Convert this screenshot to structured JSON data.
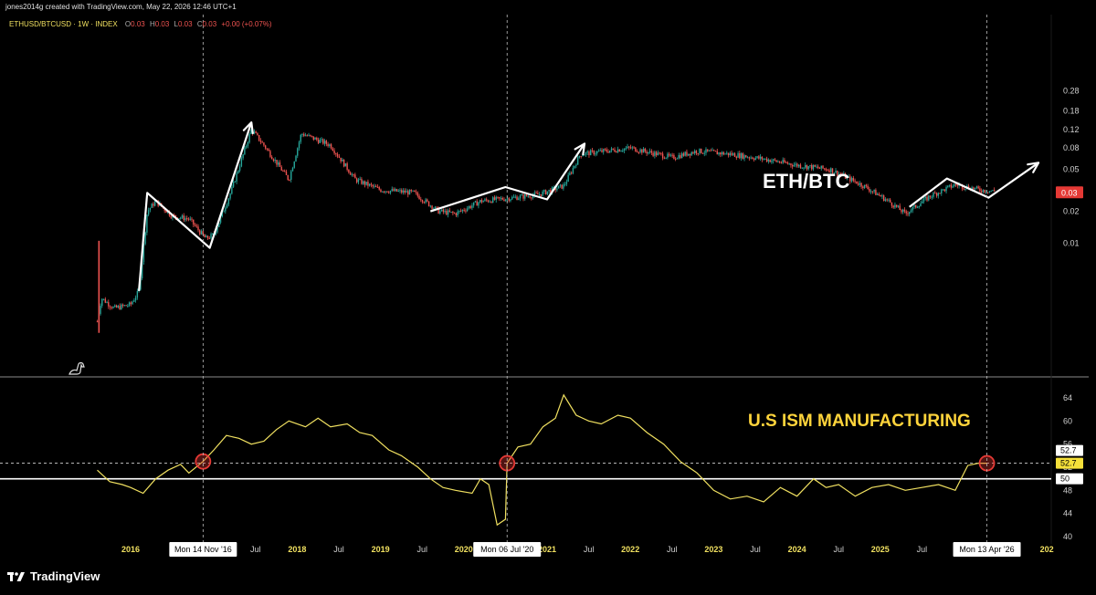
{
  "header": {
    "credit": "jones2014g created with TradingView.com, May 22, 2026 12:46 UTC+1"
  },
  "legend": {
    "symbol": "ETHUSD/BTCUSD · 1W · INDEX",
    "o_label": "O",
    "o_value": "0.03",
    "h_label": "H",
    "h_value": "0.03",
    "l_label": "L",
    "l_value": "0.03",
    "c_label": "C",
    "c_value": "0.03",
    "change": "+0.00 (+0.07%)"
  },
  "brand": {
    "name": "TradingView"
  },
  "colors": {
    "background": "#000000",
    "candle_up": "#26a69a",
    "candle_down": "#ef5350",
    "ism_line": "#f0e060",
    "annotation_text_yellow": "#ffd43b",
    "marker_red": "#e53935"
  },
  "chart_data": [
    {
      "type": "candlestick",
      "title": "ETH/BTC",
      "scale": "log",
      "y_ticks": [
        "0.28",
        "0.18",
        "0.12",
        "0.08",
        "0.05",
        "0.03",
        "0.02",
        "0.01"
      ],
      "last_value": "0.03",
      "close_path": [
        [
          2015.6,
          0.0018
        ],
        [
          2015.65,
          0.003
        ],
        [
          2015.8,
          0.0024
        ],
        [
          2016.0,
          0.0026
        ],
        [
          2016.1,
          0.0035
        ],
        [
          2016.2,
          0.02
        ],
        [
          2016.3,
          0.025
        ],
        [
          2016.5,
          0.018
        ],
        [
          2016.7,
          0.017
        ],
        [
          2016.9,
          0.011
        ],
        [
          2017.0,
          0.012
        ],
        [
          2017.2,
          0.03
        ],
        [
          2017.45,
          0.12
        ],
        [
          2017.6,
          0.085
        ],
        [
          2017.9,
          0.04
        ],
        [
          2018.05,
          0.11
        ],
        [
          2018.4,
          0.085
        ],
        [
          2018.7,
          0.04
        ],
        [
          2019.0,
          0.032
        ],
        [
          2019.4,
          0.03
        ],
        [
          2019.7,
          0.02
        ],
        [
          2019.9,
          0.019
        ],
        [
          2020.2,
          0.025
        ],
        [
          2020.6,
          0.027
        ],
        [
          2020.9,
          0.029
        ],
        [
          2021.2,
          0.035
        ],
        [
          2021.4,
          0.07
        ],
        [
          2021.7,
          0.075
        ],
        [
          2022.0,
          0.08
        ],
        [
          2022.5,
          0.065
        ],
        [
          2022.8,
          0.075
        ],
        [
          2023.2,
          0.07
        ],
        [
          2023.6,
          0.063
        ],
        [
          2024.0,
          0.055
        ],
        [
          2024.4,
          0.05
        ],
        [
          2024.8,
          0.035
        ],
        [
          2025.1,
          0.025
        ],
        [
          2025.3,
          0.019
        ],
        [
          2025.6,
          0.028
        ],
        [
          2025.9,
          0.036
        ],
        [
          2026.2,
          0.032
        ],
        [
          2026.38,
          0.031
        ]
      ],
      "annotation_arrows": [
        [
          [
            2016.1,
            0.0035
          ],
          [
            2016.2,
            0.03
          ],
          [
            2016.95,
            0.009
          ],
          [
            2017.45,
            0.14
          ]
        ],
        [
          [
            2019.6,
            0.02
          ],
          [
            2020.5,
            0.034
          ],
          [
            2021.0,
            0.026
          ],
          [
            2021.45,
            0.088
          ]
        ],
        [
          [
            2025.35,
            0.022
          ],
          [
            2025.8,
            0.041
          ],
          [
            2026.3,
            0.027
          ],
          [
            2026.9,
            0.058
          ]
        ]
      ]
    },
    {
      "type": "line",
      "title": "U.S ISM MANUFACTURING",
      "y_ticks": [
        "64",
        "60",
        "56",
        "52",
        "48",
        "44",
        "40"
      ],
      "ylim": [
        40,
        66
      ],
      "reference_line": 50,
      "current_value": "52.7",
      "current_value_2": "52.7",
      "ref_label": "50",
      "points": [
        [
          2015.6,
          51.5
        ],
        [
          2015.75,
          49.5
        ],
        [
          2015.9,
          49
        ],
        [
          2016.0,
          48.5
        ],
        [
          2016.15,
          47.5
        ],
        [
          2016.3,
          50
        ],
        [
          2016.45,
          51.5
        ],
        [
          2016.6,
          52.5
        ],
        [
          2016.7,
          51
        ],
        [
          2016.87,
          53
        ],
        [
          2017.0,
          55
        ],
        [
          2017.15,
          57.5
        ],
        [
          2017.3,
          57
        ],
        [
          2017.45,
          56
        ],
        [
          2017.6,
          56.5
        ],
        [
          2017.75,
          58.5
        ],
        [
          2017.9,
          60
        ],
        [
          2018.1,
          59
        ],
        [
          2018.25,
          60.5
        ],
        [
          2018.4,
          59
        ],
        [
          2018.6,
          59.5
        ],
        [
          2018.75,
          58
        ],
        [
          2018.9,
          57.5
        ],
        [
          2019.1,
          55
        ],
        [
          2019.25,
          54
        ],
        [
          2019.45,
          52
        ],
        [
          2019.6,
          50
        ],
        [
          2019.75,
          48.5
        ],
        [
          2019.9,
          48
        ],
        [
          2020.1,
          47.5
        ],
        [
          2020.2,
          50
        ],
        [
          2020.3,
          49
        ],
        [
          2020.4,
          42
        ],
        [
          2020.5,
          43
        ],
        [
          2020.52,
          52.7
        ],
        [
          2020.65,
          55.5
        ],
        [
          2020.8,
          56
        ],
        [
          2020.95,
          59
        ],
        [
          2021.1,
          60.5
        ],
        [
          2021.2,
          64.5
        ],
        [
          2021.35,
          61
        ],
        [
          2021.5,
          60
        ],
        [
          2021.65,
          59.5
        ],
        [
          2021.85,
          61
        ],
        [
          2022.0,
          60.5
        ],
        [
          2022.2,
          58
        ],
        [
          2022.4,
          56
        ],
        [
          2022.6,
          53
        ],
        [
          2022.8,
          51
        ],
        [
          2023.0,
          48
        ],
        [
          2023.2,
          46.5
        ],
        [
          2023.4,
          47
        ],
        [
          2023.6,
          46
        ],
        [
          2023.8,
          48.5
        ],
        [
          2024.0,
          47
        ],
        [
          2024.2,
          50
        ],
        [
          2024.35,
          48.5
        ],
        [
          2024.5,
          49
        ],
        [
          2024.7,
          47
        ],
        [
          2024.9,
          48.5
        ],
        [
          2025.1,
          49
        ],
        [
          2025.3,
          48
        ],
        [
          2025.5,
          48.5
        ],
        [
          2025.7,
          49
        ],
        [
          2025.9,
          48
        ],
        [
          2026.05,
          52.3
        ],
        [
          2026.18,
          52.7
        ],
        [
          2026.28,
          52.7
        ]
      ],
      "markers": [
        [
          2016.87,
          53.0
        ],
        [
          2020.52,
          52.7
        ],
        [
          2026.28,
          52.7
        ]
      ]
    }
  ],
  "x_axis": {
    "labels": [
      {
        "t": 2016.0,
        "text": "2016",
        "year": true
      },
      {
        "t": 2017.5,
        "text": "Jul",
        "year": false
      },
      {
        "t": 2018.0,
        "text": "2018",
        "year": true
      },
      {
        "t": 2018.5,
        "text": "Jul",
        "year": false
      },
      {
        "t": 2019.0,
        "text": "2019",
        "year": true
      },
      {
        "t": 2019.5,
        "text": "Jul",
        "year": false
      },
      {
        "t": 2020.0,
        "text": "2020",
        "year": true
      },
      {
        "t": 2021.0,
        "text": "2021",
        "year": true
      },
      {
        "t": 2021.5,
        "text": "Jul",
        "year": false
      },
      {
        "t": 2022.0,
        "text": "2022",
        "year": true
      },
      {
        "t": 2022.5,
        "text": "Jul",
        "year": false
      },
      {
        "t": 2023.0,
        "text": "2023",
        "year": true
      },
      {
        "t": 2023.5,
        "text": "Jul",
        "year": false
      },
      {
        "t": 2024.0,
        "text": "2024",
        "year": true
      },
      {
        "t": 2024.5,
        "text": "Jul",
        "year": false
      },
      {
        "t": 2025.0,
        "text": "2025",
        "year": true
      },
      {
        "t": 2025.5,
        "text": "Jul",
        "year": false
      },
      {
        "t": 2027.0,
        "text": "202",
        "year": true
      }
    ],
    "crosshairs": [
      {
        "t": 2016.87,
        "text": "Mon 14 Nov '16"
      },
      {
        "t": 2020.52,
        "text": "Mon 06 Jul '20"
      },
      {
        "t": 2026.28,
        "text": "Mon 13 Apr '26"
      }
    ]
  }
}
